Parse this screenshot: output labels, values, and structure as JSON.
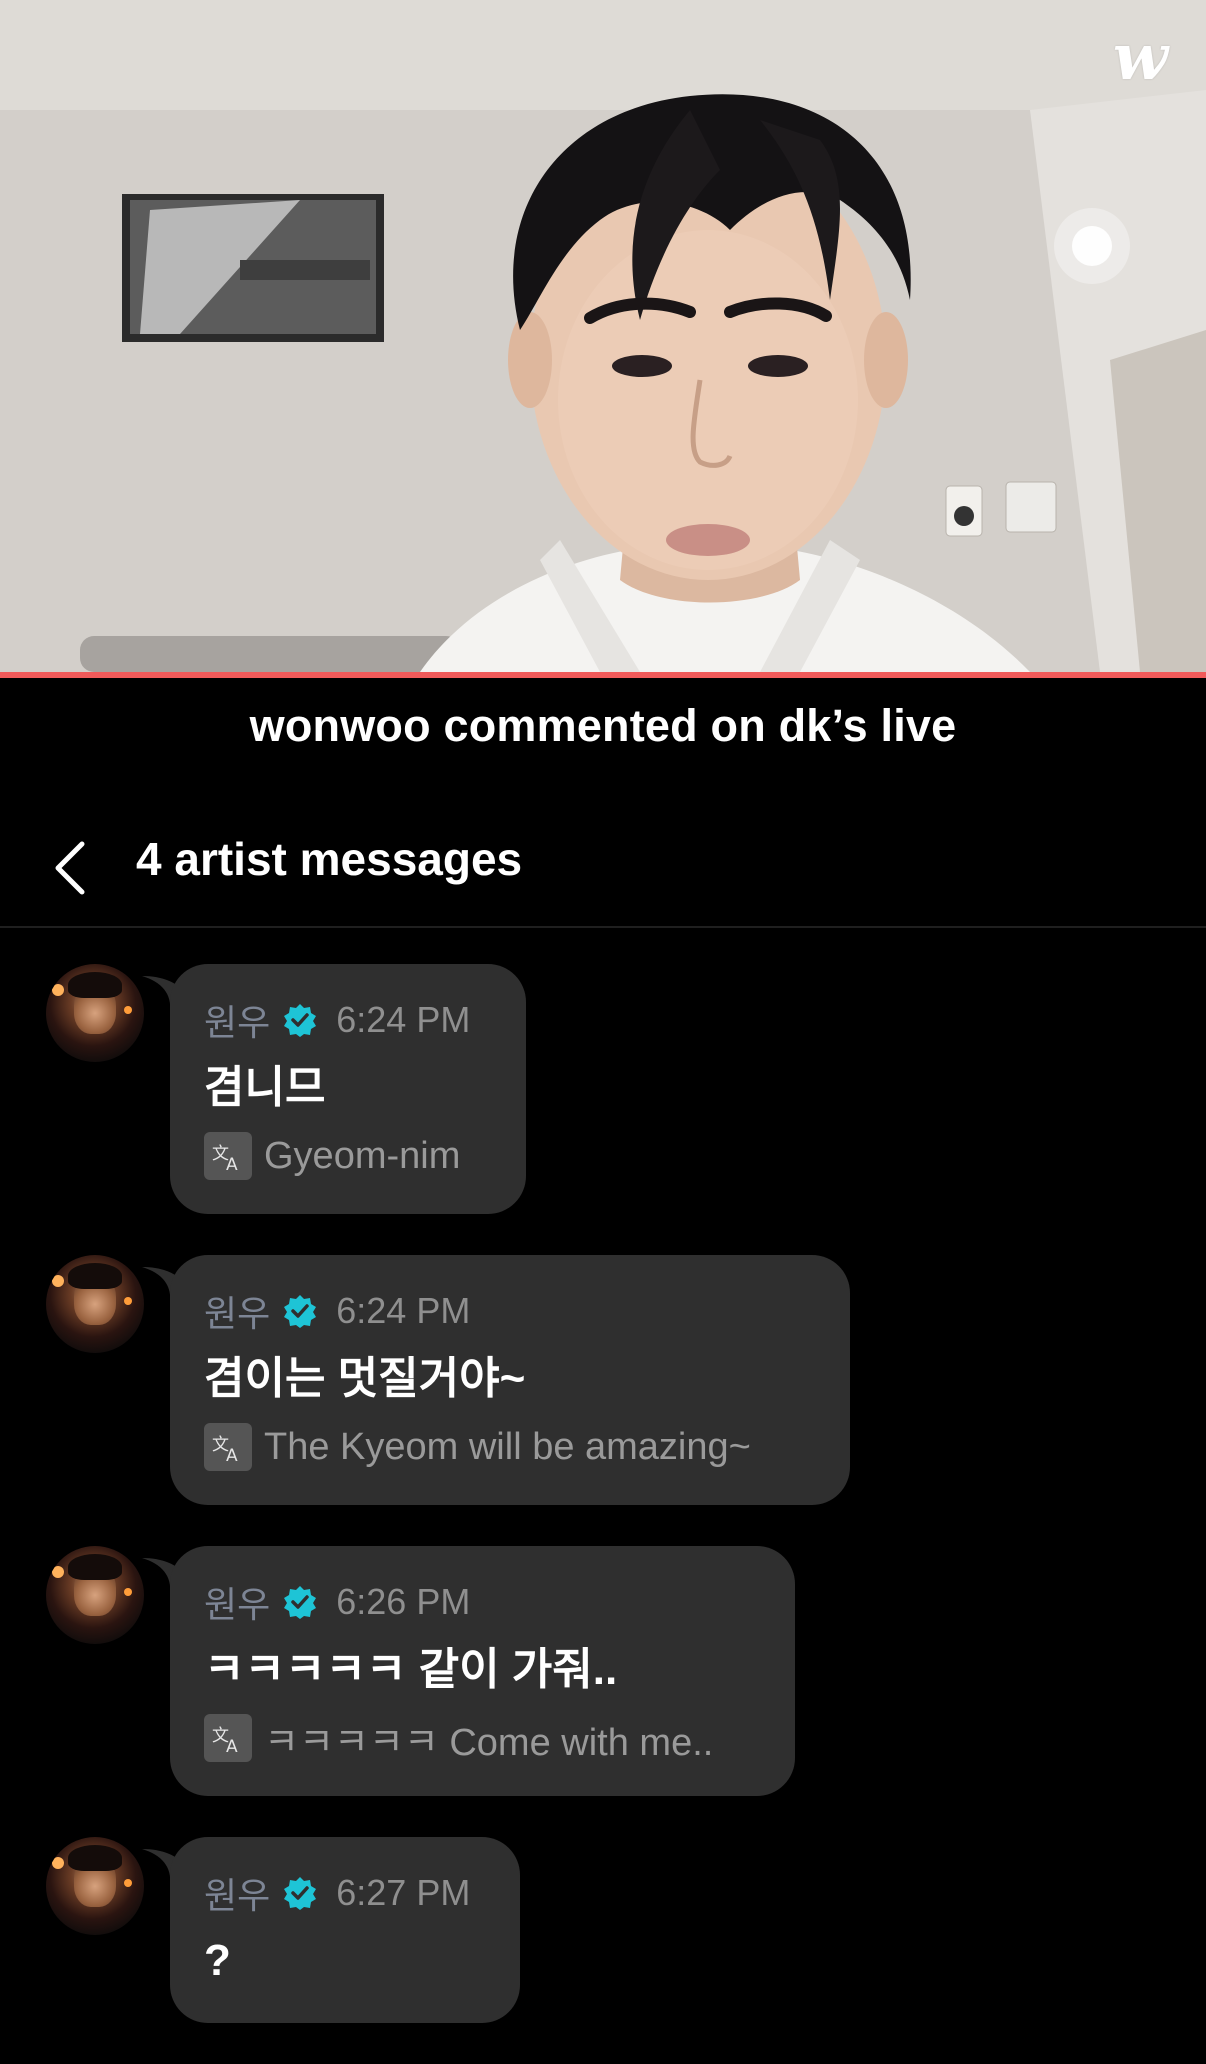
{
  "video": {
    "brand_logo": "w",
    "progress_color": "#f05a5a"
  },
  "caption": "wonwoo commented on dk’s live",
  "header": {
    "title": "4 artist messages"
  },
  "icons": {
    "back": "chevron-left-icon",
    "verified": "verified-badge-icon",
    "translate": "translate-icon"
  },
  "colors": {
    "verified": "#1ec4d6",
    "bubble": "#2f2f2f",
    "background": "#000000"
  },
  "messages": [
    {
      "author": "원우",
      "time": "6:24 PM",
      "text": "겸니므",
      "translation": "Gyeom-nim"
    },
    {
      "author": "원우",
      "time": "6:24 PM",
      "text": "겸이는 멋질거야~",
      "translation": "The Kyeom will be amazing~"
    },
    {
      "author": "원우",
      "time": "6:26 PM",
      "text": "ㅋㅋㅋㅋㅋ 같이 가줘..",
      "translation": "ㅋㅋㅋㅋㅋ Come with me.."
    },
    {
      "author": "원우",
      "time": "6:27 PM",
      "text": "?"
    }
  ]
}
